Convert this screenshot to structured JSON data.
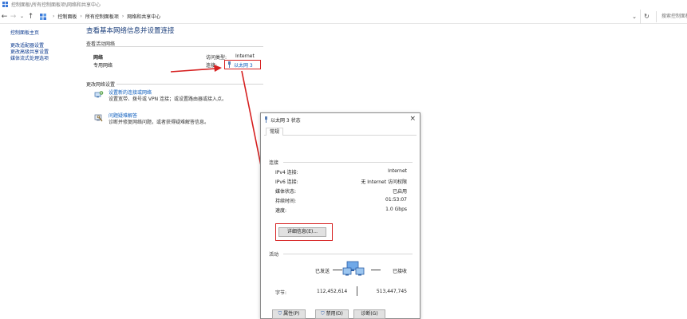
{
  "window": {
    "title": "控制面板\\所有控制面板项\\网络和共享中心"
  },
  "address": {
    "icons": {
      "back": "←",
      "forward": "→",
      "dropdown": "⌄",
      "up": "↑",
      "refresh": "↻"
    },
    "crumbs": [
      "控制面板",
      "所有控制面板项",
      "网络和共享中心"
    ],
    "search_placeholder": "搜索控制面板"
  },
  "sidebar": {
    "items": [
      {
        "label": "控制面板主页"
      },
      {
        "label": "更改适配器设置"
      },
      {
        "label": "更改高级共享设置"
      },
      {
        "label": "媒体流式处理选项"
      }
    ]
  },
  "main": {
    "title": "查看基本网络信息并设置连接",
    "active_networks_label": "查看活动网络",
    "network": {
      "name": "网络",
      "type": "专用网络",
      "access_type_label": "访问类型:",
      "access_type_value": "Internet",
      "connection_label": "连接:",
      "connection_value": "以太网 3"
    },
    "change_settings_label": "更改网络设置",
    "tasks": [
      {
        "title": "设置新的连接或网络",
        "desc": "设置宽带、拨号或 VPN 连接；或设置路由器或接入点。",
        "icon": "network-setup-icon"
      },
      {
        "title": "问题疑难解答",
        "desc": "诊断并修复网络问题，或者获得疑难解答信息。",
        "icon": "troubleshoot-icon"
      }
    ]
  },
  "dialog": {
    "title": "以太网 3 状态",
    "close_icon": "×",
    "tab": "常规",
    "connection_group": "连接",
    "rows": [
      {
        "label": "IPv4 连接:",
        "value": "Internet"
      },
      {
        "label": "IPv6 连接:",
        "value": "无 Internet 访问权限"
      },
      {
        "label": "媒体状态:",
        "value": "已启用"
      },
      {
        "label": "持续时间:",
        "value": "01:53:07"
      },
      {
        "label": "速度:",
        "value": "1.0 Gbps"
      }
    ],
    "details_button": "详细信息(E)...",
    "activity_group": "活动",
    "sent_label": "已发送",
    "received_label": "已接收",
    "bytes_label": "字节:",
    "bytes_sent": "112,452,614",
    "bytes_received": "513,447,745",
    "buttons": {
      "properties": "属性(P)",
      "disable": "禁用(D)",
      "diagnose": "诊断(G)"
    }
  },
  "colors": {
    "annotation_red": "#d62020",
    "link_blue": "#0b5cbd",
    "title_blue": "#1a3d7a"
  }
}
